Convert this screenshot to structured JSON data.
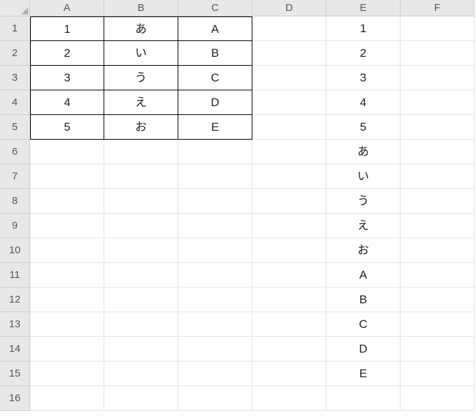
{
  "columns": [
    "A",
    "B",
    "C",
    "D",
    "E",
    "F"
  ],
  "rows": [
    "1",
    "2",
    "3",
    "4",
    "5",
    "6",
    "7",
    "8",
    "9",
    "10",
    "11",
    "12",
    "13",
    "14",
    "15",
    "16"
  ],
  "cells": {
    "A1": "1",
    "B1": "あ",
    "C1": "A",
    "E1": "1",
    "A2": "2",
    "B2": "い",
    "C2": "B",
    "E2": "2",
    "A3": "3",
    "B3": "う",
    "C3": "C",
    "E3": "3",
    "A4": "4",
    "B4": "え",
    "C4": "D",
    "E4": "4",
    "A5": "5",
    "B5": "お",
    "C5": "E",
    "E5": "5",
    "E6": "あ",
    "E7": "い",
    "E8": "う",
    "E9": "え",
    "E10": "お",
    "E11": "A",
    "E12": "B",
    "E13": "C",
    "E14": "D",
    "E15": "E"
  },
  "borderedRange": {
    "startCol": "A",
    "endCol": "C",
    "startRow": 1,
    "endRow": 5
  }
}
